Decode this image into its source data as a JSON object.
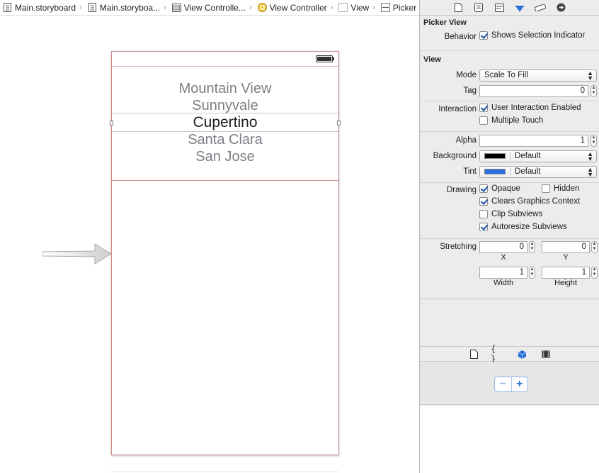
{
  "breadcrumb": [
    {
      "label": "Main.storyboard",
      "icon": "storyboard-icon"
    },
    {
      "label": "Main.storyboa...",
      "icon": "storyboard-icon"
    },
    {
      "label": "View Controlle...",
      "icon": "view-controller-scene-icon"
    },
    {
      "label": "View Controller",
      "icon": "view-controller-icon"
    },
    {
      "label": "View",
      "icon": "view-icon"
    },
    {
      "label": "Picker",
      "icon": "picker-icon"
    }
  ],
  "picker": {
    "rows": [
      "Mountain View",
      "Sunnyvale",
      "Cupertino",
      "Santa Clara",
      "San Jose"
    ],
    "selected": "Cupertino"
  },
  "inspector": {
    "picker_view": {
      "title": "Picker View",
      "behavior_label": "Behavior",
      "shows_selection_indicator": {
        "label": "Shows Selection Indicator",
        "checked": true
      }
    },
    "view": {
      "title": "View",
      "mode_label": "Mode",
      "mode_value": "Scale To Fill",
      "tag_label": "Tag",
      "tag_value": "0",
      "interaction_label": "Interaction",
      "user_interaction": {
        "label": "User Interaction Enabled",
        "checked": true
      },
      "multiple_touch": {
        "label": "Multiple Touch",
        "checked": false
      },
      "alpha_label": "Alpha",
      "alpha_value": "1",
      "background_label": "Background",
      "background_value": "Default",
      "background_color": "#000000",
      "tint_label": "Tint",
      "tint_value": "Default",
      "tint_color": "#2b6fe0",
      "drawing_label": "Drawing",
      "opaque": {
        "label": "Opaque",
        "checked": true
      },
      "hidden": {
        "label": "Hidden",
        "checked": false
      },
      "clears_graphics": {
        "label": "Clears Graphics Context",
        "checked": true
      },
      "clip_subviews": {
        "label": "Clip Subviews",
        "checked": false
      },
      "autoresize_subviews": {
        "label": "Autoresize Subviews",
        "checked": true
      },
      "stretching_label": "Stretching",
      "stretch_x": "0",
      "stretch_y": "0",
      "stretch_width": "1",
      "stretch_height": "1",
      "x_label": "X",
      "y_label": "Y",
      "width_label": "Width",
      "height_label": "Height"
    }
  },
  "library": {
    "zoom_out": "−",
    "zoom_in": "+"
  },
  "colors": {
    "device_border": "#d08a8a",
    "accent": "#2a6ed6"
  }
}
